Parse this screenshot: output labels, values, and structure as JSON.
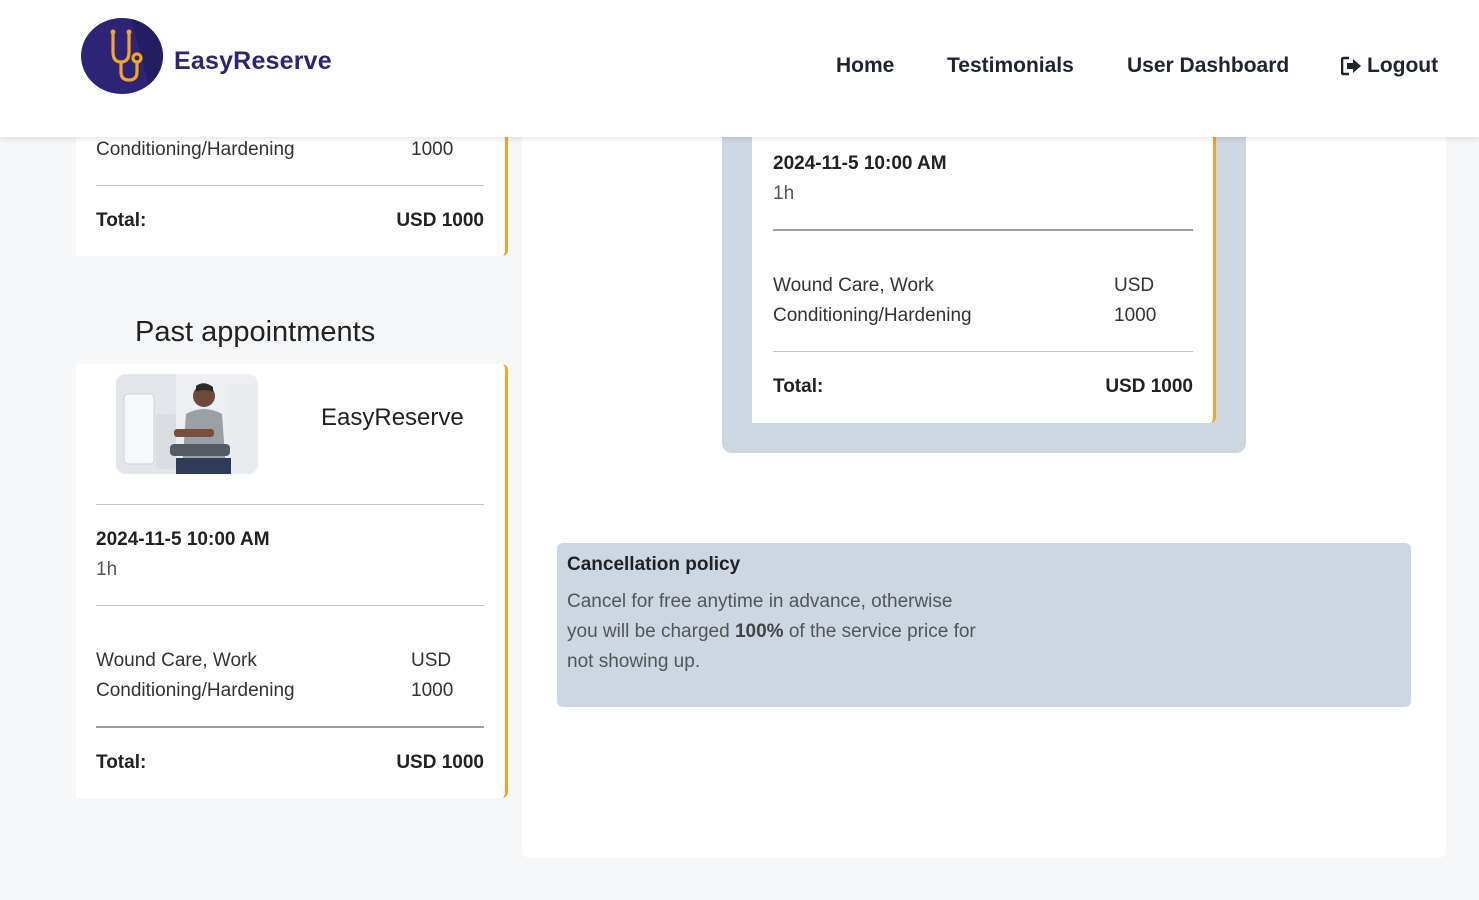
{
  "header": {
    "brand": "EasyReserve",
    "nav": {
      "home": "Home",
      "testimonials": "Testimonials",
      "dashboard": "User Dashboard",
      "logout": "Logout"
    }
  },
  "upcoming_card": {
    "service_line2": "Conditioning/Hardening",
    "price_amount": "1000",
    "total_label": "Total:",
    "total_value": "USD 1000"
  },
  "past": {
    "title": "Past appointments",
    "card": {
      "provider": "EasyReserve",
      "date": "2024-11-5 10:00 AM",
      "duration": "1h",
      "service_line1": "Wound Care, Work",
      "service_line2": "Conditioning/Hardening",
      "price_currency": "USD",
      "price_amount": "1000",
      "total_label": "Total:",
      "total_value": "USD 1000"
    }
  },
  "summary": {
    "date": "2024-11-5 10:00 AM",
    "duration": "1h",
    "service_line1": "Wound Care, Work",
    "service_line2": "Conditioning/Hardening",
    "price_currency": "USD",
    "price_amount": "1000",
    "total_label": "Total:",
    "total_value": "USD 1000"
  },
  "policy": {
    "title": "Cancellation policy",
    "text_before": "Cancel for free anytime in advance, otherwise you will be charged ",
    "percent": "100%",
    "text_after": " of the service price for not showing up."
  },
  "colors": {
    "brand": "#2e2477",
    "accent": "#f0a623",
    "panel": "#cdd7e2",
    "background": "#f6f7f9"
  },
  "icons": {
    "logo": "stethoscope-icon",
    "logout": "sign-out-icon"
  }
}
